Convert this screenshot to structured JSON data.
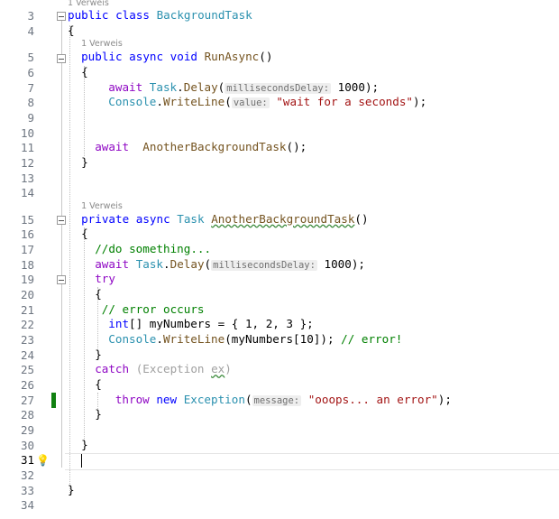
{
  "codelens": [
    {
      "text": "1 Verweis",
      "line_before": 3
    },
    {
      "text": "1 Verweis",
      "line_before": 5
    },
    {
      "text": "1 Verweis",
      "line_before": 15
    }
  ],
  "current_line": 31,
  "lines": [
    {
      "n": 3,
      "indent": 0,
      "tokens": [
        [
          "public ",
          "kw"
        ],
        [
          "class ",
          "kw"
        ],
        [
          "BackgroundTask",
          "ty"
        ]
      ]
    },
    {
      "n": 4,
      "indent": 0,
      "tokens": [
        [
          "{",
          ""
        ]
      ]
    },
    {
      "n": 5,
      "indent": 2,
      "tokens": [
        [
          "public ",
          "kw"
        ],
        [
          "async ",
          "kw"
        ],
        [
          "void ",
          "kw"
        ],
        [
          "RunAsync",
          "fn"
        ],
        [
          "()",
          ""
        ]
      ]
    },
    {
      "n": 6,
      "indent": 2,
      "tokens": [
        [
          "{",
          ""
        ]
      ]
    },
    {
      "n": 7,
      "indent": 6,
      "tokens": [
        [
          "await ",
          "ctl"
        ],
        [
          "Task",
          "ty"
        ],
        [
          ".",
          ""
        ],
        [
          "Delay",
          "fn"
        ],
        [
          "(",
          ""
        ],
        [
          "millisecondsDelay:",
          "hint"
        ],
        [
          " 1000);",
          ""
        ]
      ]
    },
    {
      "n": 8,
      "indent": 6,
      "tokens": [
        [
          "Console",
          "ty"
        ],
        [
          ".",
          ""
        ],
        [
          "WriteLine",
          "fn"
        ],
        [
          "(",
          ""
        ],
        [
          "value:",
          "hint"
        ],
        [
          " ",
          ""
        ],
        [
          "\"wait for a seconds\"",
          "str"
        ],
        [
          ");",
          ""
        ]
      ]
    },
    {
      "n": 9,
      "indent": 0,
      "tokens": []
    },
    {
      "n": 10,
      "indent": 0,
      "tokens": []
    },
    {
      "n": 11,
      "indent": 4,
      "tokens": [
        [
          "await ",
          "ctl"
        ],
        [
          " ",
          ""
        ],
        [
          "AnotherBackgroundTask",
          "fn"
        ],
        [
          "();",
          ""
        ]
      ]
    },
    {
      "n": 12,
      "indent": 2,
      "tokens": [
        [
          "}",
          ""
        ]
      ]
    },
    {
      "n": 13,
      "indent": 0,
      "tokens": []
    },
    {
      "n": 14,
      "indent": 0,
      "tokens": []
    },
    {
      "n": 15,
      "indent": 2,
      "tokens": [
        [
          "private ",
          "kw"
        ],
        [
          "async ",
          "kw"
        ],
        [
          "Task ",
          "ty"
        ],
        [
          "AnotherBackgroundTask",
          "fn sq"
        ],
        [
          "()",
          ""
        ]
      ]
    },
    {
      "n": 16,
      "indent": 2,
      "tokens": [
        [
          "{",
          ""
        ]
      ]
    },
    {
      "n": 17,
      "indent": 4,
      "tokens": [
        [
          "//do something...",
          "cm"
        ]
      ]
    },
    {
      "n": 18,
      "indent": 4,
      "tokens": [
        [
          "await ",
          "ctl"
        ],
        [
          "Task",
          "ty"
        ],
        [
          ".",
          ""
        ],
        [
          "Delay",
          "fn"
        ],
        [
          "(",
          ""
        ],
        [
          "millisecondsDelay:",
          "hint"
        ],
        [
          " 1000);",
          ""
        ]
      ]
    },
    {
      "n": 19,
      "indent": 4,
      "tokens": [
        [
          "try",
          "ctl"
        ]
      ]
    },
    {
      "n": 20,
      "indent": 4,
      "tokens": [
        [
          "{",
          ""
        ]
      ]
    },
    {
      "n": 21,
      "indent": 5,
      "tokens": [
        [
          "// error occurs",
          "cm"
        ]
      ]
    },
    {
      "n": 22,
      "indent": 6,
      "tokens": [
        [
          "int",
          "kw"
        ],
        [
          "[] myNumbers = { 1, 2, 3 };",
          ""
        ]
      ]
    },
    {
      "n": 23,
      "indent": 6,
      "tokens": [
        [
          "Console",
          "ty"
        ],
        [
          ".",
          ""
        ],
        [
          "WriteLine",
          "fn"
        ],
        [
          "(myNumbers[10]); ",
          ""
        ],
        [
          "// error!",
          "cm"
        ]
      ]
    },
    {
      "n": 24,
      "indent": 4,
      "tokens": [
        [
          "}",
          ""
        ]
      ]
    },
    {
      "n": 25,
      "indent": 4,
      "tokens": [
        [
          "catch ",
          "ctl"
        ],
        [
          "(Exception ",
          "gray"
        ],
        [
          "ex",
          "gray sq"
        ],
        [
          ")",
          "gray"
        ]
      ]
    },
    {
      "n": 26,
      "indent": 4,
      "tokens": [
        [
          "{",
          ""
        ]
      ]
    },
    {
      "n": 27,
      "indent": 7,
      "tokens": [
        [
          "throw ",
          "ctl"
        ],
        [
          "new ",
          "kw"
        ],
        [
          "Exception",
          "ty"
        ],
        [
          "(",
          ""
        ],
        [
          "message:",
          "hint"
        ],
        [
          " ",
          ""
        ],
        [
          "\"ooops... an error\"",
          "str"
        ],
        [
          ");",
          ""
        ]
      ]
    },
    {
      "n": 28,
      "indent": 4,
      "tokens": [
        [
          "}",
          ""
        ]
      ]
    },
    {
      "n": 29,
      "indent": 0,
      "tokens": []
    },
    {
      "n": 30,
      "indent": 2,
      "tokens": [
        [
          "}",
          ""
        ]
      ]
    },
    {
      "n": 31,
      "indent": 0,
      "tokens": []
    },
    {
      "n": 32,
      "indent": 0,
      "tokens": []
    },
    {
      "n": 33,
      "indent": 0,
      "tokens": [
        [
          "}",
          ""
        ]
      ]
    },
    {
      "n": 34,
      "indent": 0,
      "tokens": []
    }
  ]
}
